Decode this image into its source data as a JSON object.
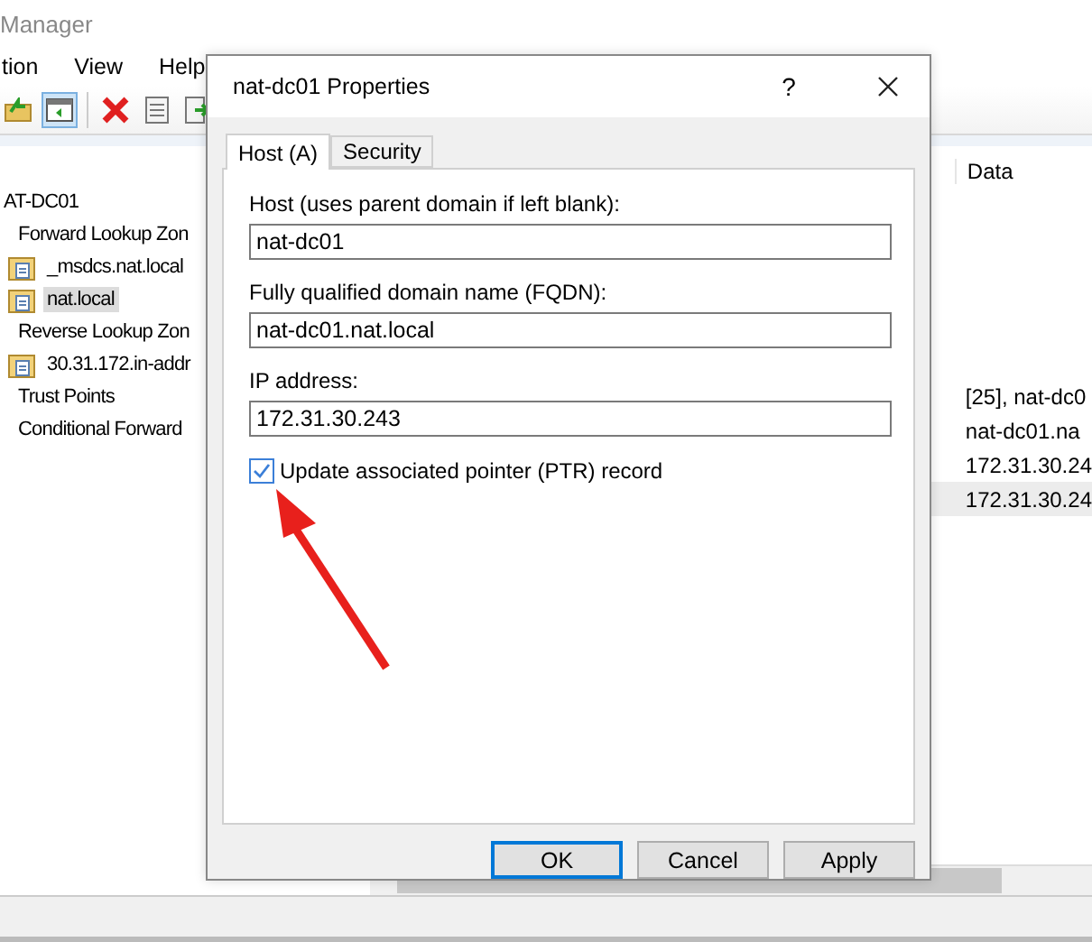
{
  "window": {
    "title": "Manager"
  },
  "menu": [
    "tion",
    "View",
    "Help"
  ],
  "toolbar": [
    {
      "kind": "up",
      "selected": false
    },
    {
      "kind": "pane",
      "selected": true
    },
    {
      "kind": "delete",
      "selected": false
    },
    {
      "kind": "properties",
      "selected": false
    },
    {
      "kind": "export",
      "selected": false
    }
  ],
  "tree": [
    {
      "label": "AT-DC01",
      "selected": false,
      "children": [
        {
          "label": "Forward Lookup Zon",
          "selected": false,
          "children": [
            {
              "label": "_msdcs.nat.local",
              "selected": false
            },
            {
              "label": "nat.local",
              "selected": true
            }
          ]
        },
        {
          "label": "Reverse Lookup Zon",
          "selected": false,
          "children": [
            {
              "label": "30.31.172.in-addr",
              "selected": false
            }
          ]
        },
        {
          "label": "Trust Points",
          "selected": false
        },
        {
          "label": "Conditional Forward",
          "selected": false
        }
      ]
    }
  ],
  "list": {
    "columns": [
      "Data"
    ],
    "rows": [
      {
        "data": "[25], nat-dc0",
        "selected": false
      },
      {
        "data": "nat-dc01.na",
        "selected": false
      },
      {
        "data": "172.31.30.24",
        "selected": false
      },
      {
        "data": "172.31.30.24",
        "selected": true
      }
    ]
  },
  "dialog": {
    "title": "nat-dc01 Properties",
    "help": "?",
    "tabs": [
      {
        "label": "Host (A)",
        "selected": true
      },
      {
        "label": "Security",
        "selected": false
      }
    ],
    "fields": [
      {
        "label": "Host (uses parent domain if left blank):",
        "value": "nat-dc01"
      },
      {
        "label": "Fully qualified domain name (FQDN):",
        "value": "nat-dc01.nat.local"
      },
      {
        "label": "IP address:",
        "value": "172.31.30.243"
      }
    ],
    "checkbox": {
      "label": "Update associated pointer (PTR) record",
      "checked": true
    },
    "buttons": [
      {
        "label": "OK",
        "default": true
      },
      {
        "label": "Cancel",
        "default": false
      },
      {
        "label": "Apply",
        "default": false
      }
    ]
  }
}
